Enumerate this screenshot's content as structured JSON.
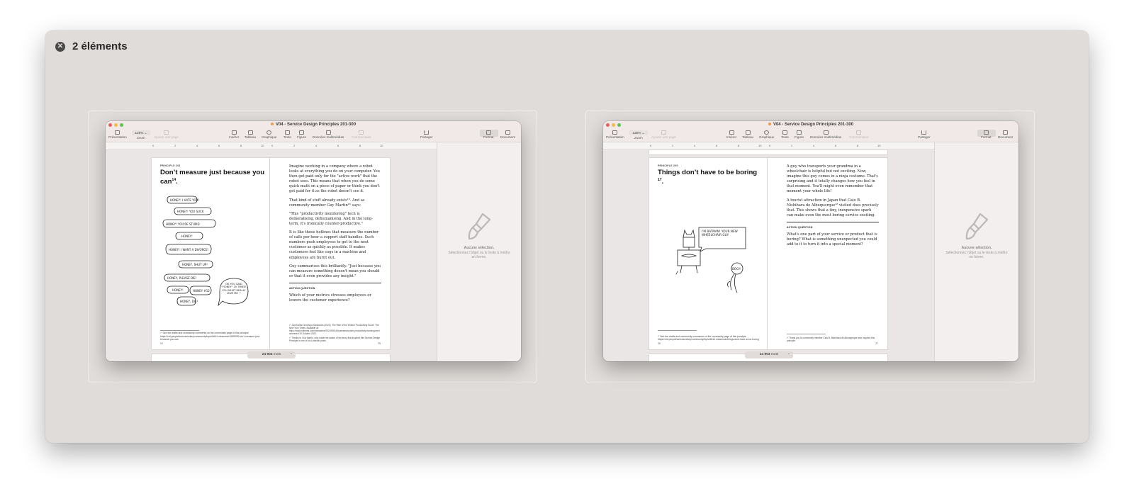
{
  "panel": {
    "title": "2 éléments"
  },
  "windows": [
    {
      "doc_title": "V04 - Service Design Principles 201-300",
      "toolbar": {
        "presentation": "Présentation",
        "zoom_value": "125%",
        "zoom": "Zoom",
        "add_page": "Ajouter une page",
        "insert": "Insérer",
        "table": "Tableau",
        "chart": "Graphique",
        "text": "Texte",
        "shape": "Figure",
        "media": "Données multimédias",
        "comment": "Commentaire",
        "share": "Partager",
        "format": "Format",
        "document": "Document"
      },
      "left_page": {
        "kicker": "PRINCIPLE 203",
        "title": "Don’t measure just because you can",
        "title_sup": "14",
        "footnote": "¹⁴ See the drafts and community comments on the community page of this principle https://ctrl.pecpsthoniculovekey/community/topic/6644.mbsmesic/1855339-dor't-measure-just-because-you-can",
        "page_number": "24",
        "illustration": {
          "bubbles": [
            "HONEY! I HATE YOU!",
            "HONEY! YOU SUCK",
            "HONEY! YOU'RE STUPID",
            "HONEY!",
            "HONEY! I WANT A DIVORCE!",
            "HONEY, SHUT UP!",
            "HONEY, PLEASE DIE!",
            "HONEY!",
            "HONEY #12",
            "HONEY, DIE!",
            "OK YOU SAID \"HONEY\" 15 TIMES! YOU MUST REALLY LOVE ME ♡"
          ]
        }
      },
      "right_page": {
        "paragraphs": [
          "Imagine working in a company where a robot looks at everything you do on your computer. You then get paid only for the \"active work\" that the robot sees. This means that when you do some quick math on a piece of paper or think you don't get paid for it as the robot doesn't see it.",
          "That kind of stuff already exists¹⁵. And as community member Guy Martin¹⁶ says:",
          "\"This \"productivity monitoring\" tech is demoralising, dehumanising. And in the long-term, it's ironically counter-productive.\"",
          "It is like those hotlines that measure the number of calls per hour a support staff handles. Such numbers push employees to get to the next customer as quickly as possible. It makes customers feel like cogs in a machine and employees are burnt out.",
          "Guy summarises this brilliantly. \"Just because you can measure something doesn't mean you should or that it even provides any insight.\""
        ],
        "action_title": "ACTION QUESTION",
        "action_text": "Which of your metrics stresses employees or lowers the customer experience?",
        "footnotes": [
          "¹⁵ Jodi Kantor and Arya Sundaram (2022). The Rise of the Worker Productivity Score. The New York Times. Available at: https://www.nytimes.com/interactive/2022/08/14/business/worker-productivity-tracking.html accessed 20 October 2022.",
          "¹⁶ Thanks to Guy Martin, who made me aware of the story that inspired this Service Design Principle in one of his LinkedIn posts."
        ],
        "page_number": "25"
      },
      "sidebar": {
        "no_selection": "Aucune sélection.",
        "hint": "Sélectionnez l’objet ou le texte à mettre en forme."
      },
      "word_count": "24 903",
      "word_unit": "mots"
    },
    {
      "doc_title": "V04 - Service Design Principles 201-300",
      "toolbar": {
        "presentation": "Présentation",
        "zoom_value": "125%",
        "zoom": "Zoom",
        "add_page": "Ajouter une page",
        "insert": "Insérer",
        "table": "Tableau",
        "chart": "Graphique",
        "text": "Texte",
        "shape": "Figure",
        "media": "Données multimédias",
        "comment": "Commentaire",
        "share": "Partager",
        "format": "Format",
        "document": "Document"
      },
      "left_page": {
        "kicker": "PRINCIPLE 205",
        "title": "Things don’t have to be boring",
        "title_sup": "17",
        "footnote": "¹⁷ See the drafts and community comments on the community page of this principle https://ctrl.pecpsthoniculovekey/community/topic/6644.mbsmesic/things-dont-have-to-be-boring",
        "page_number": "26",
        "illustration": {
          "bubbles": [
            "I'M BATMAN! YOUR NEW WHEELCHAIR GUY",
            "BOO!!"
          ]
        }
      },
      "right_page": {
        "paragraphs": [
          "A guy who transports your grandma in a wheelchair is helpful but not exciting. Now, imagine this guy comes in a ninja costume. That's surprising and it totally changes how you feel in that moment. You'll might even remember that moment your whole life!",
          "A tourist attraction in Japan that Caio B. Nishihara de Albuquerque¹⁸ visited does precisely that. This shows that a tiny, inexpensive spark can make even the most boring service exciting."
        ],
        "action_title": "ACTION QUESTION",
        "action_text": "What's one part of your service or product that is boring? What is something unexpected you could add to it to turn it into a special moment?",
        "footnotes": [
          "¹⁸ Thank you to community member Caio B. Nishihara de Albuquerque who inspired this principle."
        ],
        "page_number": "27"
      },
      "sidebar": {
        "no_selection": "Aucune sélection.",
        "hint": "Sélectionnez l’objet ou le texte à mettre en forme."
      },
      "word_count": "24 903",
      "word_unit": "mots"
    }
  ],
  "ruler": {
    "left_marks": [
      "0",
      "2",
      "4",
      "6",
      "8",
      "10"
    ],
    "right_marks": [
      "0",
      "2",
      "4",
      "6",
      "8",
      "10"
    ]
  },
  "colors": {
    "panel_bg": "#e0dcd9",
    "close_red": "#ee5f58",
    "minimize_yellow": "#f4bd40",
    "zoom_green": "#5fc44d",
    "doc_dot": "#f29b45"
  }
}
